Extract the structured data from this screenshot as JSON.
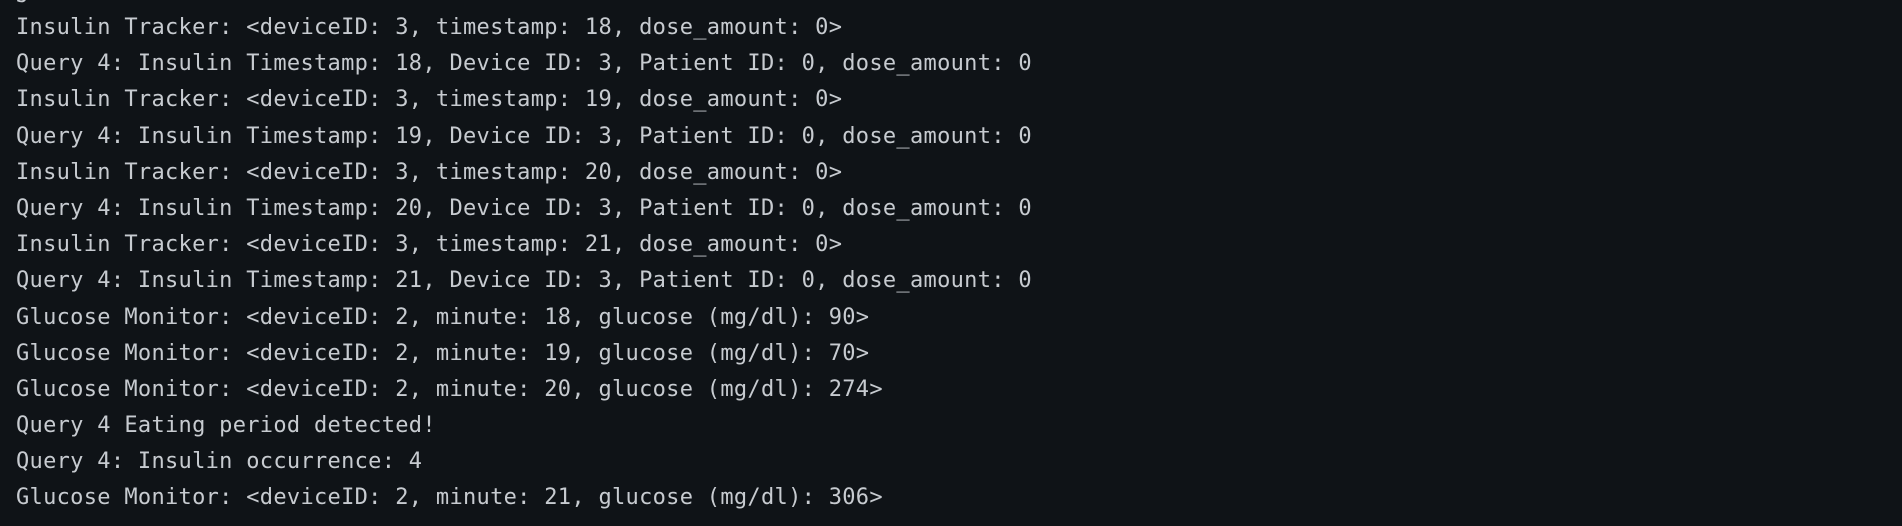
{
  "terminal": {
    "partial_top_line": "J",
    "lines": [
      "Insulin Tracker: <deviceID: 3, timestamp: 18, dose_amount: 0>",
      "Query 4: Insulin Timestamp: 18, Device ID: 3, Patient ID: 0, dose_amount: 0",
      "Insulin Tracker: <deviceID: 3, timestamp: 19, dose_amount: 0>",
      "Query 4: Insulin Timestamp: 19, Device ID: 3, Patient ID: 0, dose_amount: 0",
      "Insulin Tracker: <deviceID: 3, timestamp: 20, dose_amount: 0>",
      "Query 4: Insulin Timestamp: 20, Device ID: 3, Patient ID: 0, dose_amount: 0",
      "Insulin Tracker: <deviceID: 3, timestamp: 21, dose_amount: 0>",
      "Query 4: Insulin Timestamp: 21, Device ID: 3, Patient ID: 0, dose_amount: 0",
      "Glucose Monitor: <deviceID: 2, minute: 18, glucose (mg/dl): 90>",
      "Glucose Monitor: <deviceID: 2, minute: 19, glucose (mg/dl): 70>",
      "Glucose Monitor: <deviceID: 2, minute: 20, glucose (mg/dl): 274>",
      "Query 4 Eating period detected!",
      "Query 4: Insulin occurrence: 4",
      "Glucose Monitor: <deviceID: 2, minute: 21, glucose (mg/dl): 306>"
    ]
  },
  "colors": {
    "background": "#0f1317",
    "text": "#c7cbd0"
  }
}
